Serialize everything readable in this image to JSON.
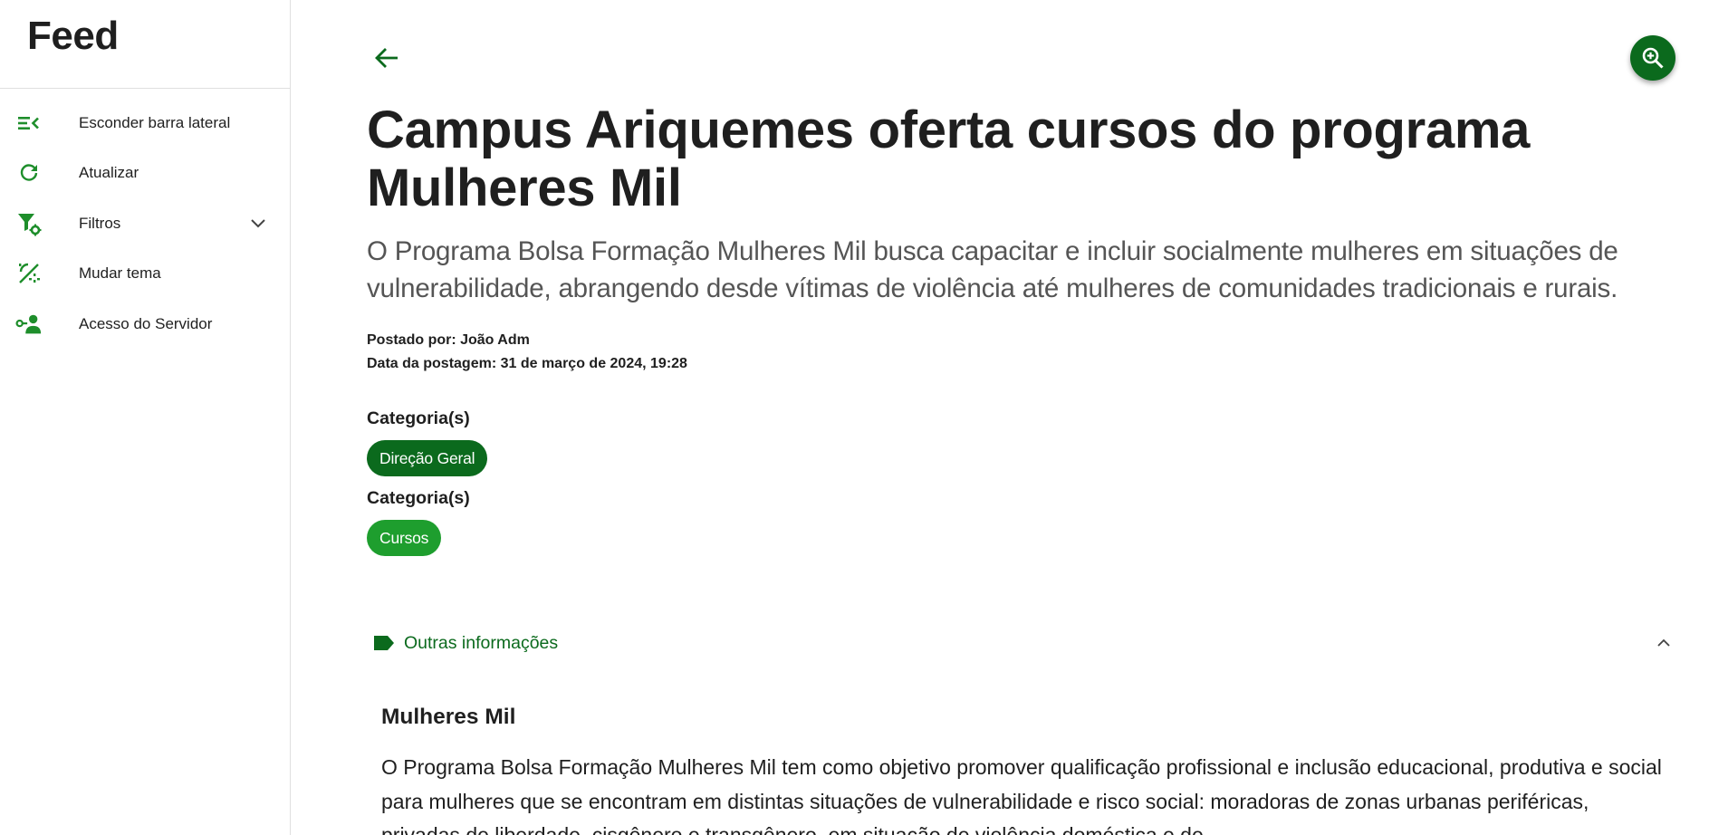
{
  "sidebar": {
    "title": "Feed",
    "items": [
      {
        "label": "Esconder barra lateral",
        "icon": "menu-collapse-icon"
      },
      {
        "label": "Atualizar",
        "icon": "refresh-icon"
      },
      {
        "label": "Filtros",
        "icon": "filter-settings-icon",
        "expandable": true
      },
      {
        "label": "Mudar tema",
        "icon": "theme-icon"
      },
      {
        "label": "Acesso do Servidor",
        "icon": "user-key-icon"
      }
    ]
  },
  "article": {
    "title": "Campus Ariquemes oferta cursos do programa Mulheres Mil",
    "subtitle": "O Programa Bolsa Formação Mulheres Mil busca capacitar e incluir socialmente mulheres em situações de vulnerabilidade, abrangendo desde vítimas de violência até mulheres de comunidades tradicionais e rurais.",
    "posted_by": "Postado por: João Adm",
    "posted_date": "Data da postagem: 31 de março de 2024, 19:28",
    "categories": [
      {
        "heading": "Categoria(s)",
        "chip": "Direção Geral"
      },
      {
        "heading": "Categoria(s)",
        "chip": "Cursos"
      }
    ]
  },
  "other_info": {
    "label": "Outras informações",
    "expanded": true
  },
  "section": {
    "title": "Mulheres Mil",
    "body": "O Programa Bolsa Formação Mulheres Mil tem como objetivo promover qualificação profissional e inclusão educacional, produtiva e social para mulheres que se encontram em distintas situações de vulnerabilidade e risco social: moradoras de zonas urbanas periféricas, privadas de liberdade, cisgênero e transgênero, em situação de violência doméstica e de"
  },
  "colors": {
    "primary": "#0b6a1d",
    "accent": "#1e9e2e",
    "icon": "#1e8e2b"
  }
}
